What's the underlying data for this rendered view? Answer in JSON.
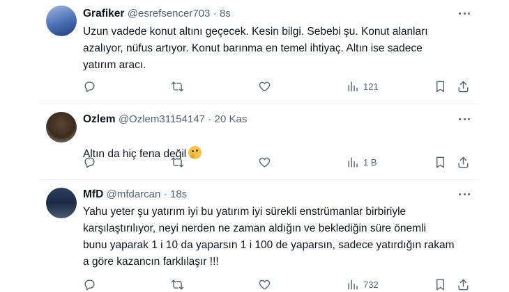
{
  "tweets": [
    {
      "name": "Grafiker",
      "handle": "@esrefsencer703",
      "separator": "·",
      "time": "8s",
      "text": "Uzun vadede konut altını geçecek. Kesin bilgi. Sebebi şu. Konut alanları\nazalıyor, nüfus artıyor. Konut barınma en temel ihtiyaç. Altın ise sadece\nyatırım aracı.",
      "views": "121"
    },
    {
      "name": "Ozlem",
      "handle": "@Ozlem31154147",
      "separator": "·",
      "time": "20 Kas",
      "text": "Altın da hiç fena değil",
      "emoji": "thinking-face",
      "views": "1 B"
    },
    {
      "name": "MfD",
      "handle": "@mfdarcan",
      "separator": "·",
      "time": "18s",
      "text": "Yahu yeter şu yatırım iyi bu yatırım iyi sürekli enstrümanlar birbiriyle\nkarşılaştırılıyor, neyi nerden ne zaman aldığın ve beklediğin süre önemli\nbunu yaparak 1 i 10 da yaparsın 1 i 100 de yaparsın, sadece yatırdığın rakam\na göre kazancın farklılaşır !!!",
      "views": "732"
    }
  ],
  "icons": {
    "reply": "reply-icon",
    "retweet": "retweet-icon",
    "like": "like-icon",
    "views": "views-icon",
    "bookmark": "bookmark-icon",
    "share": "share-icon",
    "more": "more-icon"
  },
  "colors": {
    "text": "#0f1419",
    "secondary": "#536471",
    "divider": "#eff3f4"
  }
}
